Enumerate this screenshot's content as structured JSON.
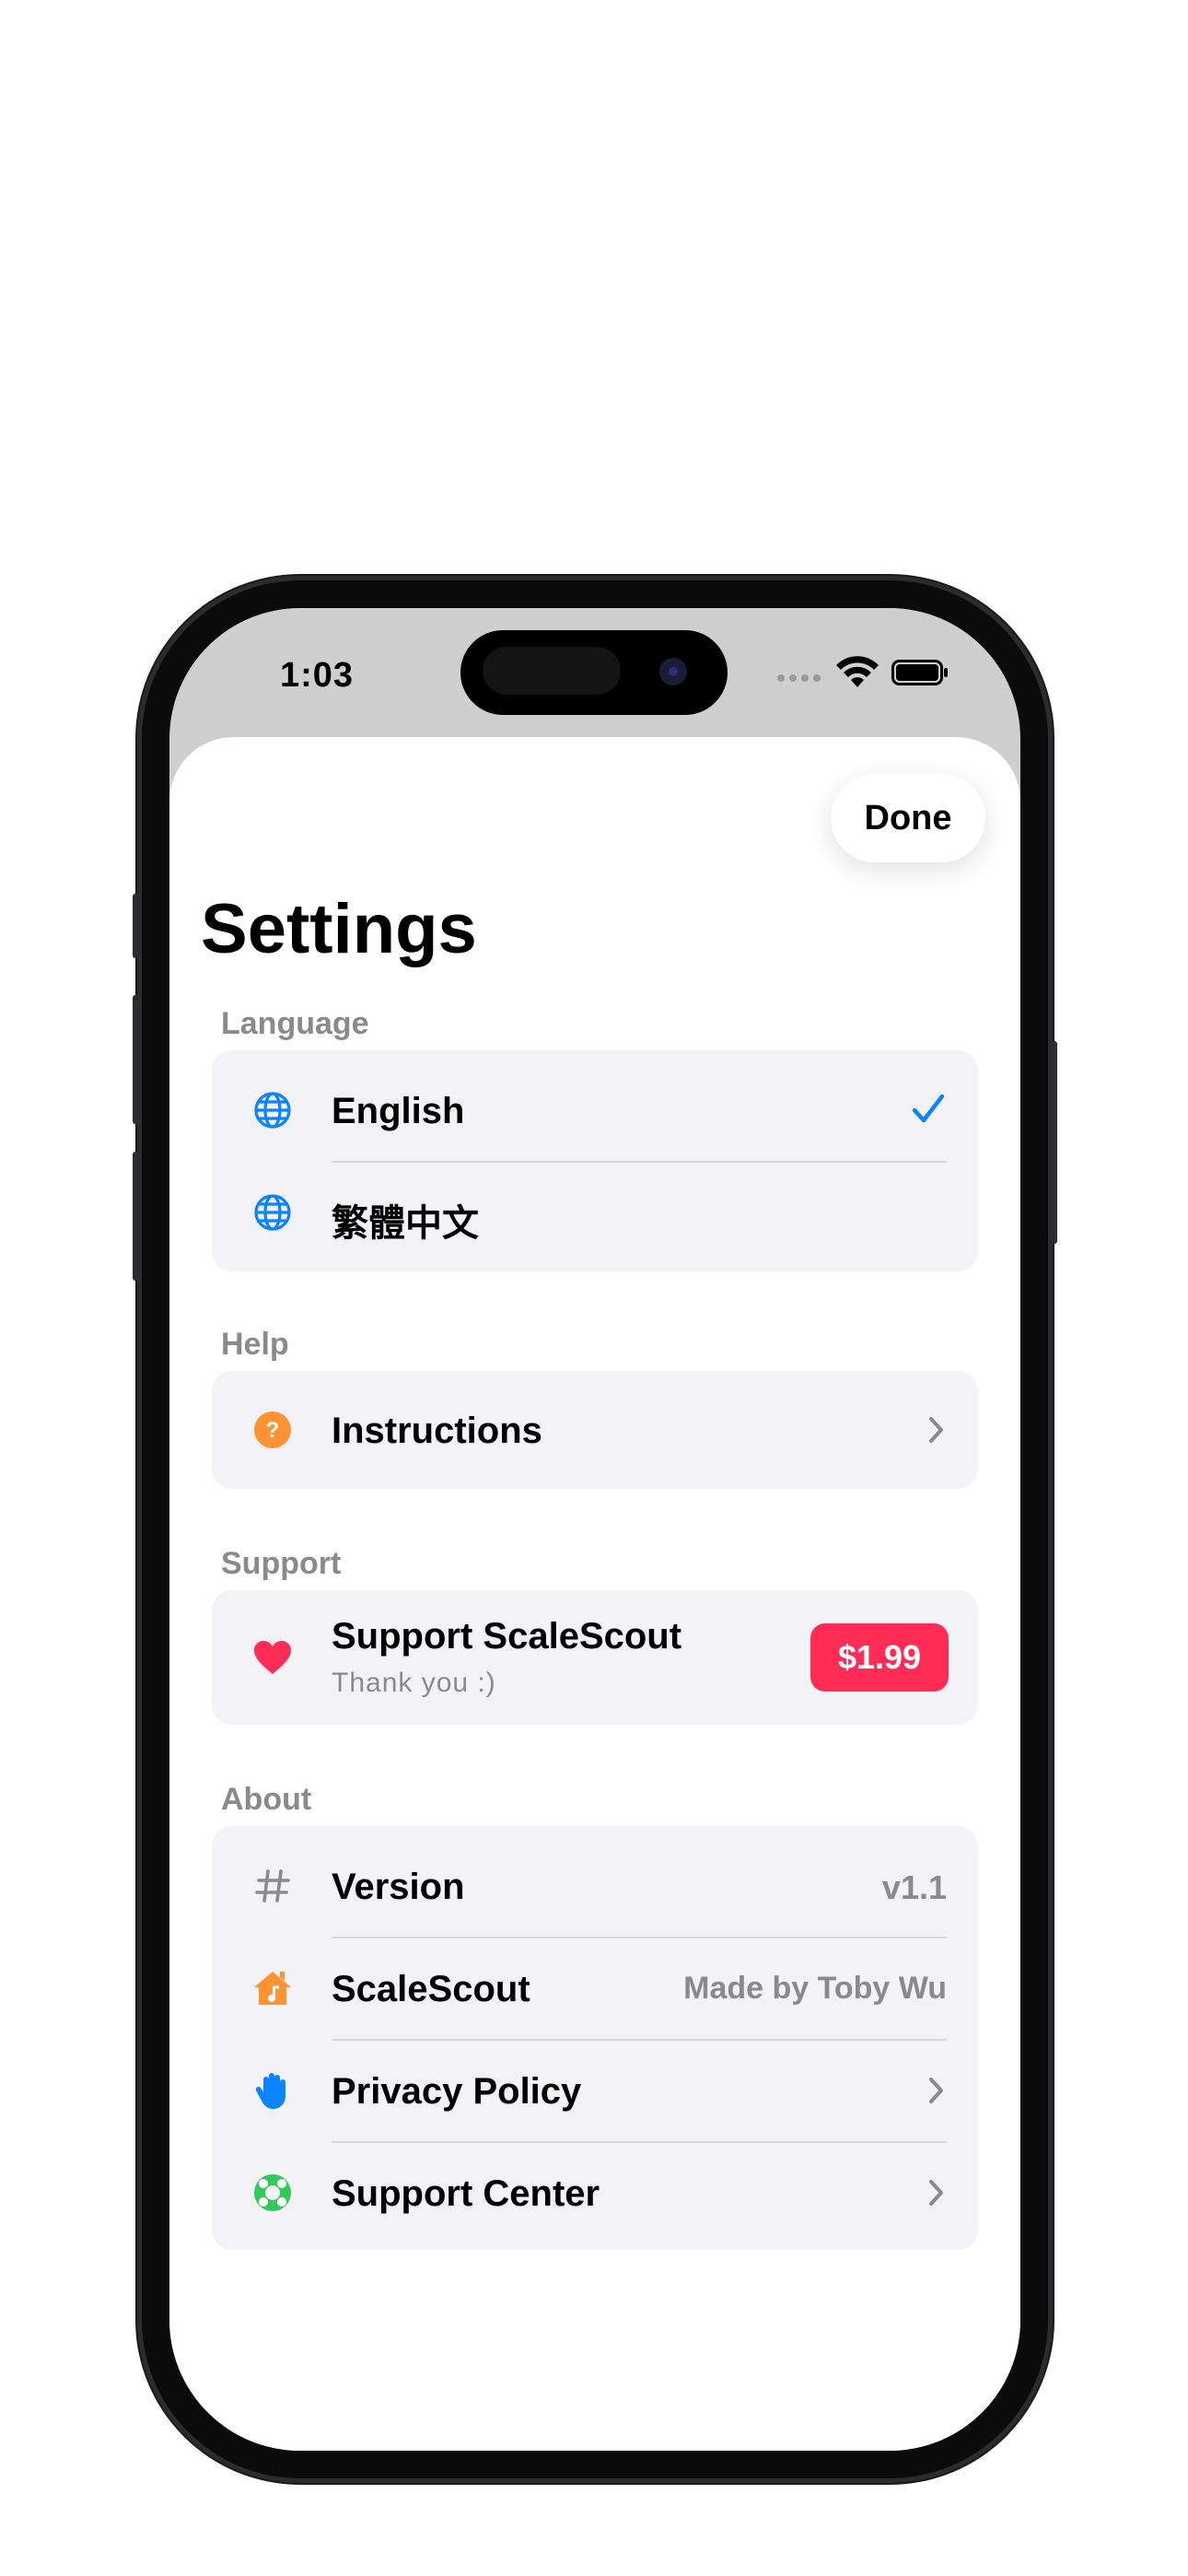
{
  "status_bar": {
    "time": "1:03"
  },
  "header": {
    "done_label": "Done",
    "title": "Settings"
  },
  "sections": {
    "language": {
      "header": "Language",
      "items": [
        {
          "label": "English",
          "icon": "globe-icon",
          "selected": true
        },
        {
          "label": "繁體中文",
          "icon": "globe-icon",
          "selected": false
        }
      ]
    },
    "help": {
      "header": "Help",
      "items": [
        {
          "label": "Instructions",
          "icon": "question-circle-icon"
        }
      ]
    },
    "support": {
      "header": "Support",
      "item": {
        "label": "Support ScaleScout",
        "subtitle": "Thank you :)",
        "price": "$1.99",
        "icon": "heart-icon"
      }
    },
    "about": {
      "header": "About",
      "items": [
        {
          "label": "Version",
          "value": "v1.1",
          "icon": "hashtag-icon"
        },
        {
          "label": "ScaleScout",
          "value": "Made by Toby Wu",
          "icon": "house-music-icon"
        },
        {
          "label": "Privacy Policy",
          "icon": "hand-raised-icon"
        },
        {
          "label": "Support Center",
          "icon": "lifebuoy-icon"
        }
      ]
    }
  },
  "colors": {
    "accent_blue": "#0a84ff",
    "orange": "#ff9233",
    "pink": "#ff2d55",
    "green": "#34c759",
    "secondary_text": "#8a8a8e",
    "group_bg": "#f2f2f7"
  }
}
